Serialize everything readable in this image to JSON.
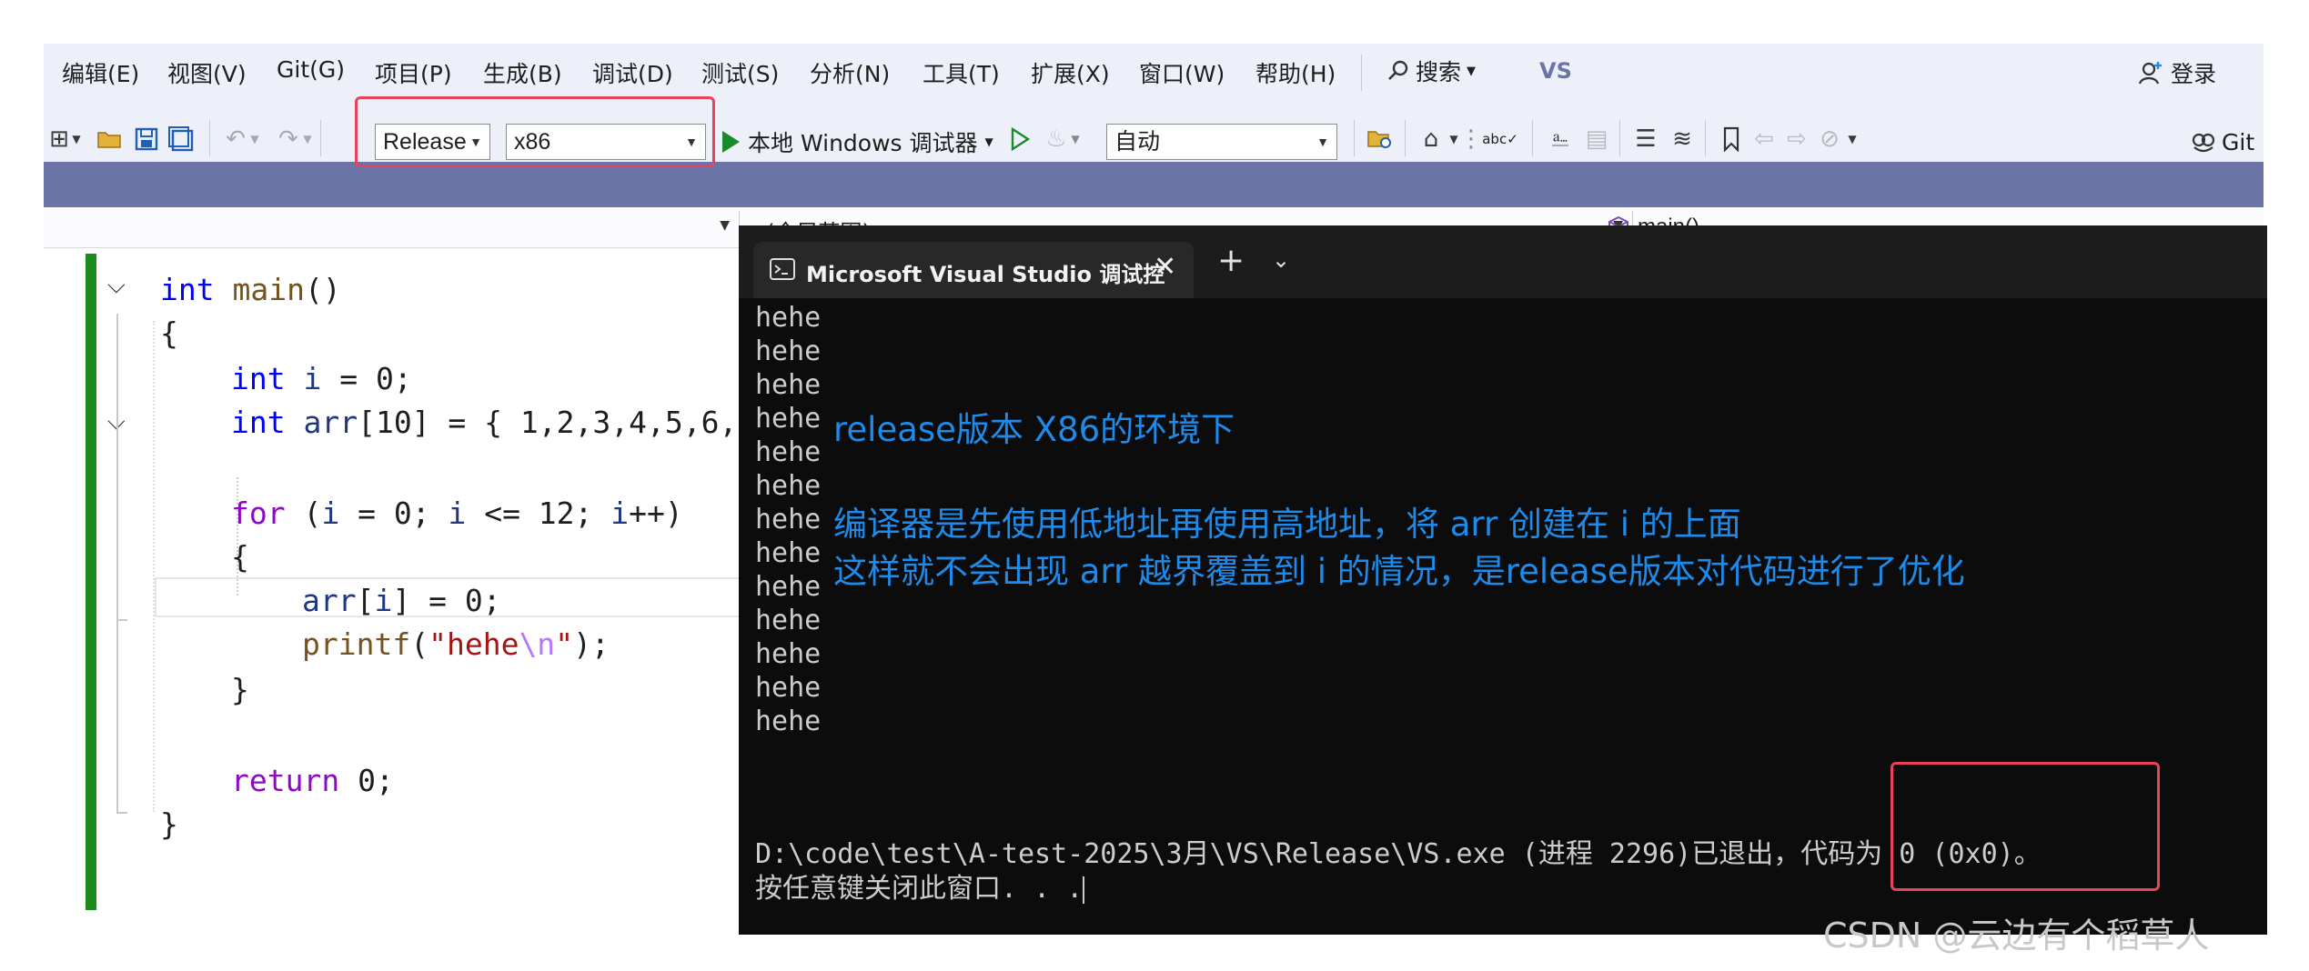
{
  "menu": [
    "编辑(E)",
    "视图(V)",
    "Git(G)",
    "项目(P)",
    "生成(B)",
    "调试(D)",
    "测试(S)",
    "分析(N)",
    "工具(T)",
    "扩展(X)",
    "窗口(W)",
    "帮助(H)"
  ],
  "search_label": "搜索",
  "vs_badge": "VS",
  "login_label": "登录",
  "github_label": "Git",
  "toolbar": {
    "config": "Release",
    "platform": "x86",
    "run_label": "本地 Windows 调试器",
    "auto": "自动"
  },
  "navbar": {
    "scope": "(全局范围)",
    "member": "main()"
  },
  "code": {
    "line1_kw": "int",
    "line1_fn": "main",
    "line1_rest": "()",
    "line2": "{",
    "line3_kw": "int",
    "line3_var": "i",
    "line3_rest": " = 0;",
    "line4_kw": "int",
    "line4_var": "arr",
    "line4_rest": "[10] = { 1,2,3,4,5,6,",
    "line5_kw": "for",
    "line5_a": " (",
    "line5_v1": "i",
    "line5_b": " = 0; ",
    "line5_v2": "i",
    "line5_c": " <= 12; ",
    "line5_v3": "i",
    "line5_d": "++)",
    "line6": "{",
    "line7_var": "arr",
    "line7_a": "[",
    "line7_v": "i",
    "line7_b": "] = 0;",
    "line8_fn": "printf",
    "line8_a": "(",
    "line8_str": "\"hehe",
    "line8_esc": "\\n",
    "line8_str2": "\"",
    "line8_b": ");",
    "line9": "}",
    "line10_kw": "return",
    "line10_rest": " 0;",
    "line11": "}"
  },
  "terminal": {
    "tab_title": "Microsoft Visual Studio 调试控",
    "output_lines": [
      "hehe",
      "hehe",
      "hehe",
      "hehe",
      "hehe",
      "hehe",
      "hehe",
      "hehe",
      "hehe",
      "hehe",
      "hehe",
      "hehe",
      "hehe"
    ],
    "exit_line": "D:\\code\\test\\A-test-2025\\3月\\VS\\Release\\VS.exe (进程 2296)已退出，代码为 0 (0x0)。",
    "press_line": "按任意键关闭此窗口. . ."
  },
  "annotations": {
    "a1": "release版本  X86的环境下",
    "a2": "编译器是先使用低地址再使用高地址，将 arr 创建在 i 的上面",
    "a3": "这样就不会出现 arr 越界覆盖到 i 的情况，是release版本对代码进行了优化"
  },
  "watermark": "CSDN @云边有个稻草人",
  "colors": {
    "menubar_bg": "#eef0f9",
    "band": "#6a74a6",
    "highlight_box": "#e8435a",
    "annotation_text": "#1e8bea",
    "gutter_green": "#1c8a1c"
  }
}
